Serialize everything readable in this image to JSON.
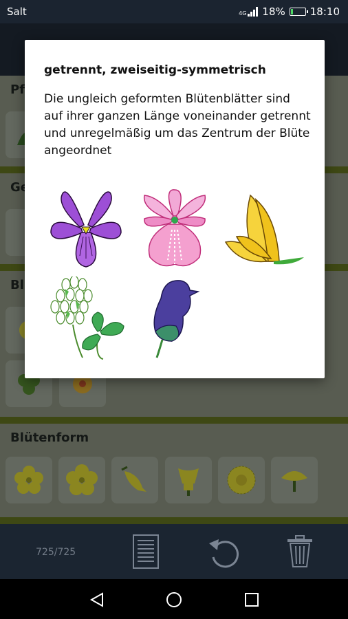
{
  "status_bar": {
    "carrier": "Salt",
    "battery": "18%",
    "time": "18:10",
    "battery_level": 0.18
  },
  "background": {
    "section_1_title": "Pf",
    "section_2_title": "Ge",
    "section_3_title": "Bl",
    "section_4_title": "Blütenform"
  },
  "dialog": {
    "title": "getrennt, zweiseitig-symmetrisch",
    "body": "Die ungleich geformten Blütenblätter sind auf ihrer ganzen Länge voneinander getrennt und unregelmäßig um das Zentrum der Blüte angeordnet",
    "images": [
      "violet-flower",
      "orchid-flower",
      "pea-flower-yellow",
      "clover-flower",
      "monkshood-flower"
    ]
  },
  "bottom_bar": {
    "counter": "725/725",
    "icons": [
      "list-icon",
      "undo-icon",
      "trash-icon"
    ]
  },
  "nav_bar": {
    "icons": [
      "back-icon",
      "home-icon",
      "recents-icon"
    ]
  },
  "colors": {
    "accent_green": "#59681e",
    "dialog_bg": "#ffffff",
    "status_bar": "#1b2430"
  }
}
